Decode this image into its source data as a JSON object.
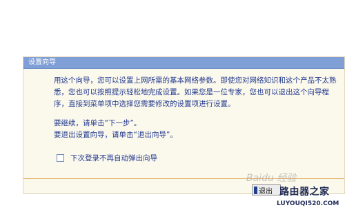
{
  "dialog": {
    "title": "设置向导",
    "paragraphs": [
      "用这个向导，您可以设置上网所需的基本网络参数。即使您对网络知识和这个产品不太熟悉，您也可以按照提示轻松地完成设置。如果您是一位专家，您也可以退出这个向导程序，直接到菜单项中选择您需要修改的设置项进行设置。",
      "要继续，请单击“下一步”。",
      "要退出设置向导，请单击“退出向导”。"
    ],
    "checkbox_label": "下次登录不再自动弹出向导",
    "checkbox_checked": false,
    "exit_button_label": "退出"
  },
  "watermarks": {
    "baidu": "Baidu 经验",
    "site_name": "路由器之家",
    "site_url": "LUYOUQI520.COM"
  },
  "colors": {
    "titlebar": "#7f9fd6",
    "dialog_bg": "#fbf8ec",
    "text": "#223a8f",
    "footer_line": "#e5b36a"
  }
}
